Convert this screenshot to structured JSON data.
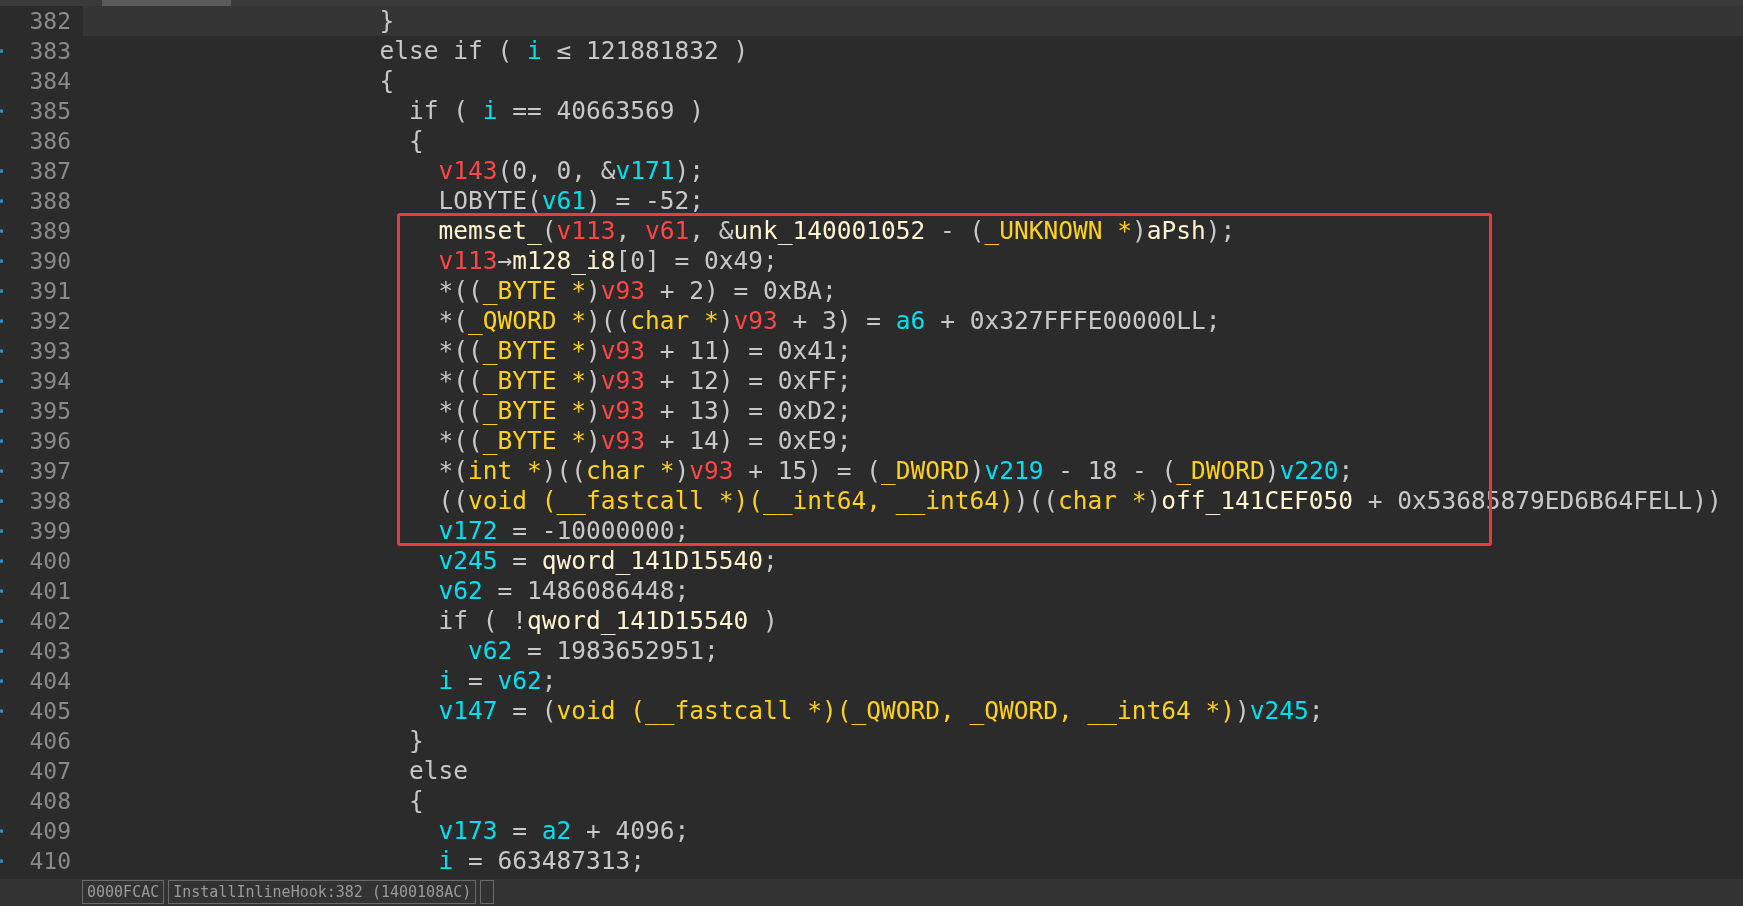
{
  "code_lines": [
    {
      "number": "382",
      "marker": false,
      "highlighted": true,
      "tokens": [
        {
          "kind": "plain",
          "text": "                  }"
        }
      ]
    },
    {
      "number": "383",
      "marker": true,
      "highlighted": false,
      "tokens": [
        {
          "kind": "plain",
          "text": "                  else if ( "
        },
        {
          "kind": "local",
          "text": "i"
        },
        {
          "kind": "plain",
          "text": " ≤ 121881832 )"
        }
      ]
    },
    {
      "number": "384",
      "marker": false,
      "highlighted": false,
      "tokens": [
        {
          "kind": "plain",
          "text": "                  {"
        }
      ]
    },
    {
      "number": "385",
      "marker": true,
      "highlighted": false,
      "tokens": [
        {
          "kind": "plain",
          "text": "                    if ( "
        },
        {
          "kind": "local",
          "text": "i"
        },
        {
          "kind": "plain",
          "text": " == 40663569 )"
        }
      ]
    },
    {
      "number": "386",
      "marker": false,
      "highlighted": false,
      "tokens": [
        {
          "kind": "plain",
          "text": "                    {"
        }
      ]
    },
    {
      "number": "387",
      "marker": true,
      "highlighted": false,
      "tokens": [
        {
          "kind": "func",
          "text": "                      v143"
        },
        {
          "kind": "plain",
          "text": "(0, 0, &"
        },
        {
          "kind": "local",
          "text": "v171"
        },
        {
          "kind": "plain",
          "text": ");"
        }
      ]
    },
    {
      "number": "388",
      "marker": true,
      "highlighted": false,
      "tokens": [
        {
          "kind": "plain",
          "text": "                      LOBYTE("
        },
        {
          "kind": "local",
          "text": "v61"
        },
        {
          "kind": "plain",
          "text": ") = -52;"
        }
      ]
    },
    {
      "number": "389",
      "marker": true,
      "highlighted": false,
      "tokens": [
        {
          "kind": "global",
          "text": "                      memset_"
        },
        {
          "kind": "plain",
          "text": "("
        },
        {
          "kind": "func",
          "text": "v113"
        },
        {
          "kind": "plain",
          "text": ", "
        },
        {
          "kind": "func",
          "text": "v61"
        },
        {
          "kind": "plain",
          "text": ", &"
        },
        {
          "kind": "global",
          "text": "unk_140001052"
        },
        {
          "kind": "plain",
          "text": " - ("
        },
        {
          "kind": "type",
          "text": "_UNKNOWN *"
        },
        {
          "kind": "plain",
          "text": ")"
        },
        {
          "kind": "global",
          "text": "aPsh"
        },
        {
          "kind": "plain",
          "text": ");"
        }
      ]
    },
    {
      "number": "390",
      "marker": true,
      "highlighted": false,
      "tokens": [
        {
          "kind": "func",
          "text": "                      v113"
        },
        {
          "kind": "plain",
          "text": "→"
        },
        {
          "kind": "global",
          "text": "m128_i8"
        },
        {
          "kind": "plain",
          "text": "[0] = 0x49;"
        }
      ]
    },
    {
      "number": "391",
      "marker": true,
      "highlighted": false,
      "tokens": [
        {
          "kind": "plain",
          "text": "                      *(("
        },
        {
          "kind": "type",
          "text": "_BYTE *"
        },
        {
          "kind": "plain",
          "text": ")"
        },
        {
          "kind": "func",
          "text": "v93"
        },
        {
          "kind": "plain",
          "text": " + 2) = 0xBA;"
        }
      ]
    },
    {
      "number": "392",
      "marker": true,
      "highlighted": false,
      "tokens": [
        {
          "kind": "plain",
          "text": "                      *("
        },
        {
          "kind": "type",
          "text": "_QWORD *"
        },
        {
          "kind": "plain",
          "text": ")(("
        },
        {
          "kind": "type",
          "text": "char *"
        },
        {
          "kind": "plain",
          "text": ")"
        },
        {
          "kind": "func",
          "text": "v93"
        },
        {
          "kind": "plain",
          "text": " + 3) = "
        },
        {
          "kind": "local",
          "text": "a6"
        },
        {
          "kind": "plain",
          "text": " + 0x327FFFE00000LL;"
        }
      ]
    },
    {
      "number": "393",
      "marker": true,
      "highlighted": false,
      "tokens": [
        {
          "kind": "plain",
          "text": "                      *(("
        },
        {
          "kind": "type",
          "text": "_BYTE *"
        },
        {
          "kind": "plain",
          "text": ")"
        },
        {
          "kind": "func",
          "text": "v93"
        },
        {
          "kind": "plain",
          "text": " + 11) = 0x41;"
        }
      ]
    },
    {
      "number": "394",
      "marker": true,
      "highlighted": false,
      "tokens": [
        {
          "kind": "plain",
          "text": "                      *(("
        },
        {
          "kind": "type",
          "text": "_BYTE *"
        },
        {
          "kind": "plain",
          "text": ")"
        },
        {
          "kind": "func",
          "text": "v93"
        },
        {
          "kind": "plain",
          "text": " + 12) = 0xFF;"
        }
      ]
    },
    {
      "number": "395",
      "marker": true,
      "highlighted": false,
      "tokens": [
        {
          "kind": "plain",
          "text": "                      *(("
        },
        {
          "kind": "type",
          "text": "_BYTE *"
        },
        {
          "kind": "plain",
          "text": ")"
        },
        {
          "kind": "func",
          "text": "v93"
        },
        {
          "kind": "plain",
          "text": " + 13) = 0xD2;"
        }
      ]
    },
    {
      "number": "396",
      "marker": true,
      "highlighted": false,
      "tokens": [
        {
          "kind": "plain",
          "text": "                      *(("
        },
        {
          "kind": "type",
          "text": "_BYTE *"
        },
        {
          "kind": "plain",
          "text": ")"
        },
        {
          "kind": "func",
          "text": "v93"
        },
        {
          "kind": "plain",
          "text": " + 14) = 0xE9;"
        }
      ]
    },
    {
      "number": "397",
      "marker": true,
      "highlighted": false,
      "tokens": [
        {
          "kind": "plain",
          "text": "                      *("
        },
        {
          "kind": "type",
          "text": "int *"
        },
        {
          "kind": "plain",
          "text": ")(("
        },
        {
          "kind": "type",
          "text": "char *"
        },
        {
          "kind": "plain",
          "text": ")"
        },
        {
          "kind": "func",
          "text": "v93"
        },
        {
          "kind": "plain",
          "text": " + 15) = ("
        },
        {
          "kind": "type",
          "text": "_DWORD"
        },
        {
          "kind": "plain",
          "text": ")"
        },
        {
          "kind": "local",
          "text": "v219"
        },
        {
          "kind": "plain",
          "text": " - 18 - ("
        },
        {
          "kind": "type",
          "text": "_DWORD"
        },
        {
          "kind": "plain",
          "text": ")"
        },
        {
          "kind": "local",
          "text": "v220"
        },
        {
          "kind": "plain",
          "text": ";"
        }
      ]
    },
    {
      "number": "398",
      "marker": true,
      "highlighted": false,
      "tokens": [
        {
          "kind": "plain",
          "text": "                      (("
        },
        {
          "kind": "type",
          "text": "void (__fastcall *)(__int64, __int64)"
        },
        {
          "kind": "plain",
          "text": ")(("
        },
        {
          "kind": "type",
          "text": "char *"
        },
        {
          "kind": "plain",
          "text": ")"
        },
        {
          "kind": "global",
          "text": "off_141CEF050"
        },
        {
          "kind": "plain",
          "text": " + 0x53685879ED6B64FELL))"
        }
      ]
    },
    {
      "number": "399",
      "marker": true,
      "highlighted": false,
      "tokens": [
        {
          "kind": "local",
          "text": "                      v172"
        },
        {
          "kind": "plain",
          "text": " = -10000000;"
        }
      ]
    },
    {
      "number": "400",
      "marker": true,
      "highlighted": false,
      "tokens": [
        {
          "kind": "local",
          "text": "                      v245"
        },
        {
          "kind": "plain",
          "text": " = "
        },
        {
          "kind": "global",
          "text": "qword_141D15540"
        },
        {
          "kind": "plain",
          "text": ";"
        }
      ]
    },
    {
      "number": "401",
      "marker": true,
      "highlighted": false,
      "tokens": [
        {
          "kind": "local",
          "text": "                      v62"
        },
        {
          "kind": "plain",
          "text": " = 1486086448;"
        }
      ]
    },
    {
      "number": "402",
      "marker": true,
      "highlighted": false,
      "tokens": [
        {
          "kind": "plain",
          "text": "                      if ( !"
        },
        {
          "kind": "global",
          "text": "qword_141D15540"
        },
        {
          "kind": "plain",
          "text": " )"
        }
      ]
    },
    {
      "number": "403",
      "marker": true,
      "highlighted": false,
      "tokens": [
        {
          "kind": "local",
          "text": "                        v62"
        },
        {
          "kind": "plain",
          "text": " = 1983652951;"
        }
      ]
    },
    {
      "number": "404",
      "marker": true,
      "highlighted": false,
      "tokens": [
        {
          "kind": "local",
          "text": "                      i"
        },
        {
          "kind": "plain",
          "text": " = "
        },
        {
          "kind": "local",
          "text": "v62"
        },
        {
          "kind": "plain",
          "text": ";"
        }
      ]
    },
    {
      "number": "405",
      "marker": true,
      "highlighted": false,
      "tokens": [
        {
          "kind": "local",
          "text": "                      v147"
        },
        {
          "kind": "plain",
          "text": " = ("
        },
        {
          "kind": "type",
          "text": "void (__fastcall *)(_QWORD, _QWORD, __int64 *)"
        },
        {
          "kind": "plain",
          "text": ")"
        },
        {
          "kind": "local",
          "text": "v245"
        },
        {
          "kind": "plain",
          "text": ";"
        }
      ]
    },
    {
      "number": "406",
      "marker": false,
      "highlighted": false,
      "tokens": [
        {
          "kind": "plain",
          "text": "                    }"
        }
      ]
    },
    {
      "number": "407",
      "marker": false,
      "highlighted": false,
      "tokens": [
        {
          "kind": "plain",
          "text": "                    else"
        }
      ]
    },
    {
      "number": "408",
      "marker": false,
      "highlighted": false,
      "tokens": [
        {
          "kind": "plain",
          "text": "                    {"
        }
      ]
    },
    {
      "number": "409",
      "marker": true,
      "highlighted": false,
      "tokens": [
        {
          "kind": "local",
          "text": "                      v173"
        },
        {
          "kind": "plain",
          "text": " = "
        },
        {
          "kind": "local",
          "text": "a2"
        },
        {
          "kind": "plain",
          "text": " + 4096;"
        }
      ]
    },
    {
      "number": "410",
      "marker": true,
      "highlighted": false,
      "tokens": [
        {
          "kind": "local",
          "text": "                      i"
        },
        {
          "kind": "plain",
          "text": " = 663487313;"
        }
      ]
    }
  ],
  "status_bar": {
    "address": "0000FCAC",
    "location": "InstallInlineHook:382 (1400108AC)"
  }
}
